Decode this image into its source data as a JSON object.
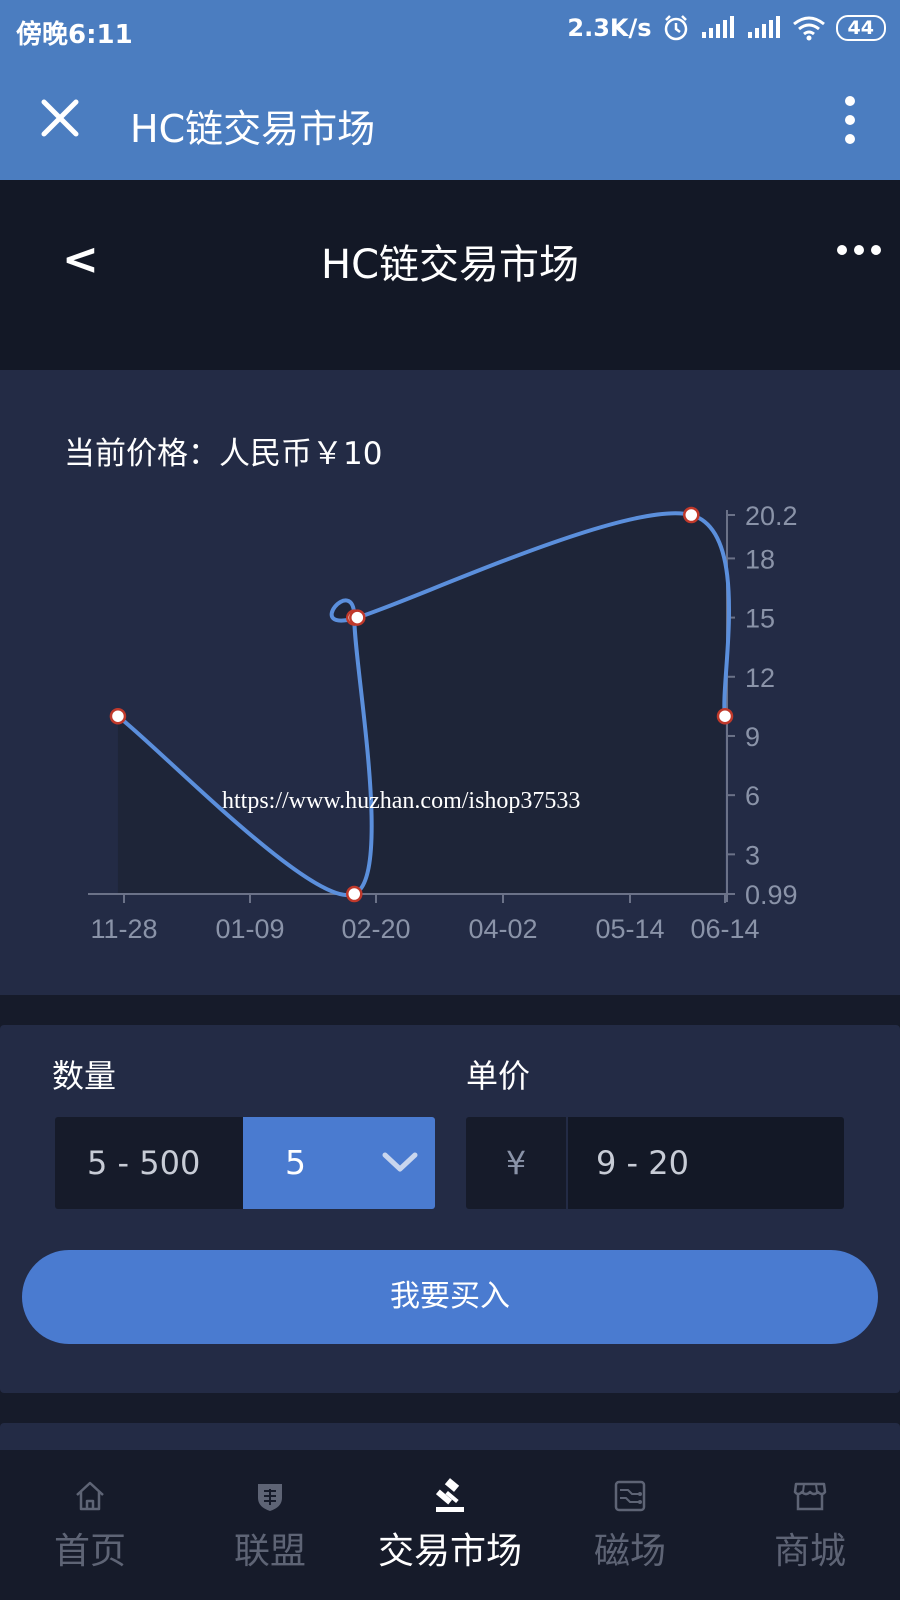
{
  "status_bar": {
    "time": "傍晚6:11",
    "network_speed": "2.3K/s",
    "battery": "44"
  },
  "app_bar": {
    "title": "HC链交易市场",
    "close_icon": "close-icon",
    "menu_icon": "vertical-dots-icon"
  },
  "page_header": {
    "back_label": "<",
    "title": "HC链交易市场",
    "more_icon": "horizontal-dots-icon"
  },
  "price": {
    "label": "当前价格：人民币￥10"
  },
  "watermark": "https://www.huzhan.com/ishop37533",
  "chart_data": {
    "type": "line",
    "title": "",
    "xlabel": "",
    "ylabel": "",
    "x_ticks": [
      "11-28",
      "01-09",
      "02-20",
      "04-02",
      "05-14",
      "06-14"
    ],
    "y_ticks": [
      0.99,
      3,
      6,
      9,
      12,
      15,
      18,
      20.2
    ],
    "ylim": [
      0.99,
      20.2
    ],
    "x": [
      "11-26",
      "02-12",
      "02-12",
      "02-13",
      "06-03",
      "06-14"
    ],
    "y": [
      10,
      0.99,
      15,
      15,
      20.2,
      10
    ],
    "grid": false,
    "y_axis_position": "right",
    "line_color": "#5b8fdc",
    "marker_fill": "#ffffff",
    "marker_stroke": "#c0392b"
  },
  "trade": {
    "quantity_label": "数量",
    "quantity_range": "5 - 500",
    "quantity_selected": "5",
    "unit_price_label": "单价",
    "currency_symbol": "¥",
    "price_range": "9 - 20",
    "buy_button": "我要买入"
  },
  "nav": [
    {
      "label": "首页",
      "icon": "home-icon",
      "active": false
    },
    {
      "label": "联盟",
      "icon": "alliance-shield-icon",
      "active": false
    },
    {
      "label": "交易市场",
      "icon": "gavel-icon",
      "active": true
    },
    {
      "label": "磁场",
      "icon": "circuit-icon",
      "active": false
    },
    {
      "label": "商城",
      "icon": "store-icon",
      "active": false
    }
  ],
  "colors": {
    "primary": "#4b7dc0",
    "button": "#4a7bd0",
    "panel": "#232b45",
    "background": "#161b2a"
  }
}
